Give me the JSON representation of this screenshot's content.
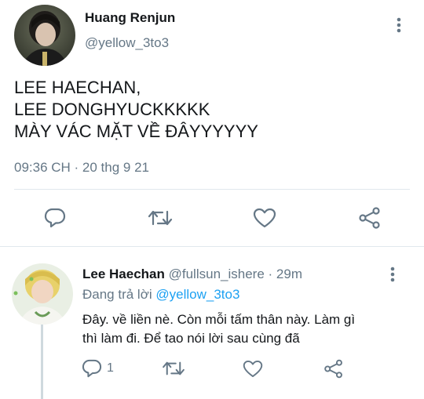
{
  "tweet": {
    "author_name": "Huang Renjun",
    "author_handle": "@yellow_3to3",
    "text_lines": [
      "LEE HAECHAN,",
      "LEE DONGHYUCKKKKK",
      "MÀY VÁC MẶT VỀ ĐÂYYYYYY"
    ],
    "timestamp": "09:36 CH · 20 thg 9 21",
    "actions": [
      {
        "name": "reply-icon"
      },
      {
        "name": "retweet-icon"
      },
      {
        "name": "like-icon"
      },
      {
        "name": "share-icon"
      }
    ],
    "more_icon": "more-vertical-icon"
  },
  "reply": {
    "author_name": "Lee Haechan",
    "author_handle": "@fullsun_ishere",
    "separator": "·",
    "age": "29m",
    "replying_prefix": "Đang trả lời",
    "replying_to": "@yellow_3to3",
    "text_lines": [
      "Đây. về liền nè. Còn mỗi tấm thân này. Làm gì",
      "thì làm đi. Để tao nói lời sau cùng đã"
    ],
    "reply_count": "1",
    "more_icon": "more-vertical-icon"
  },
  "colors": {
    "text": "#14171a",
    "muted": "#657786",
    "accent": "#1da1f2",
    "divider": "#e1e8ed",
    "thread_line": "#cfd9de"
  }
}
